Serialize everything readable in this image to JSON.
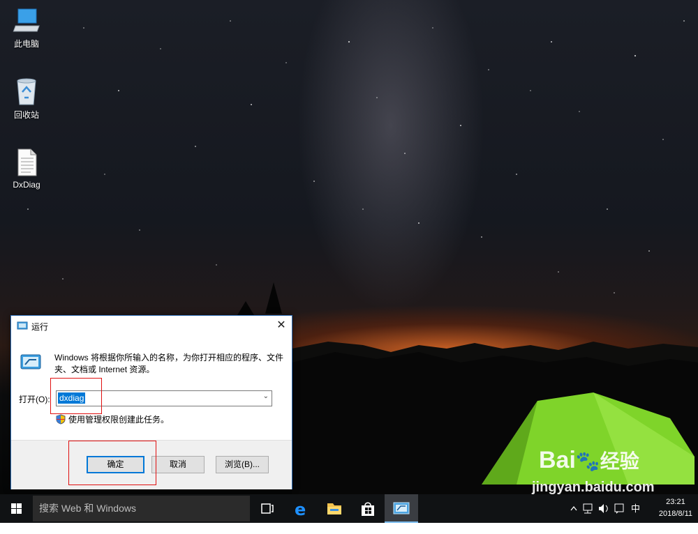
{
  "desktop": {
    "icons": [
      {
        "label": "此电脑",
        "icon": "computer-icon"
      },
      {
        "label": "回收站",
        "icon": "recycle-bin-icon"
      },
      {
        "label": "DxDiag",
        "icon": "text-file-icon"
      }
    ]
  },
  "run_dialog": {
    "title": "运行",
    "close_glyph": "✕",
    "description": "Windows 将根据你所输入的名称，为你打开相应的程序、文件夹、文档或 Internet 资源。",
    "open_label": "打开(O):",
    "input_value": "dxdiag",
    "admin_note": "使用管理权限创建此任务。",
    "buttons": {
      "ok": "确定",
      "cancel": "取消",
      "browse": "浏览(B)..."
    },
    "highlight_color": "#e01010"
  },
  "taskbar": {
    "search_placeholder": "搜索 Web 和 Windows",
    "pinned": [
      "task-view-icon",
      "edge-icon",
      "file-explorer-icon",
      "store-icon",
      "run-icon"
    ],
    "tray": {
      "ime": "中",
      "time": "23:21",
      "date": "2018/8/11"
    }
  },
  "watermark": {
    "brand": "Bai",
    "brand2": "经验",
    "url": "jingyan.baidu.com"
  },
  "colors": {
    "accent": "#0078d7",
    "taskbar": "#101214"
  }
}
